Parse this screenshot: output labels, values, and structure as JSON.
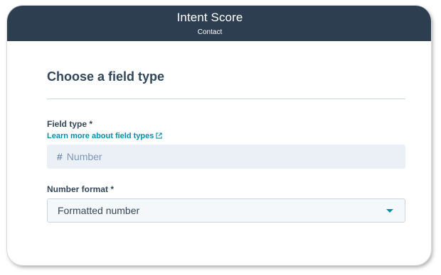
{
  "header": {
    "title": "Intent Score",
    "subtitle": "Contact"
  },
  "section": {
    "title": "Choose a field type"
  },
  "field_type": {
    "label": "Field type *",
    "help_link": "Learn more about field types",
    "help_link_icon": "external-link-icon",
    "icon": "hash-icon",
    "value": "Number"
  },
  "number_format": {
    "label": "Number format *",
    "selected": "Formatted number",
    "dropdown_icon": "caret-down-icon"
  },
  "colors": {
    "header_bg": "#2d3e50",
    "link": "#0091ae",
    "text": "#33475b",
    "readonly_bg": "#eaf0f6"
  }
}
